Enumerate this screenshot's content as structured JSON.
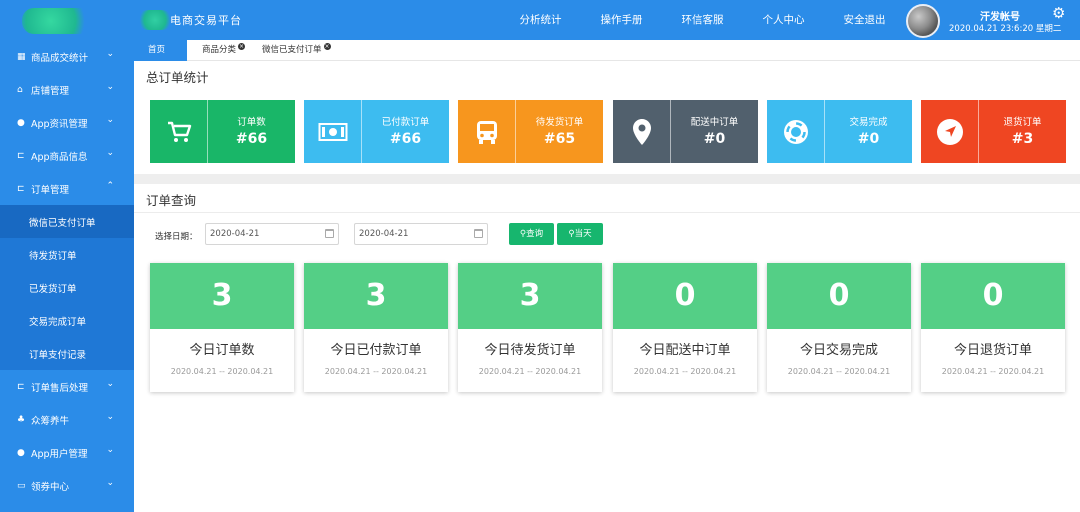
{
  "header": {
    "app_title": "电商交易平台",
    "nav": [
      "分析统计",
      "操作手册",
      "环信客服",
      "个人中心",
      "安全退出"
    ],
    "user_name": "汗发帐号",
    "datetime": "2020.04.21 23:6:20 星期二"
  },
  "sidebar": {
    "items": [
      {
        "label": "商品成交统计",
        "icon": "chart-icon"
      },
      {
        "label": "店铺管理",
        "icon": "store-icon"
      },
      {
        "label": "App资讯管理",
        "icon": "leaf-icon"
      },
      {
        "label": "App商品信息",
        "icon": "cart-icon"
      },
      {
        "label": "订单管理",
        "icon": "cart-icon"
      }
    ],
    "sub_items": [
      "微信已支付订单",
      "待发货订单",
      "已发货订单",
      "交易完成订单",
      "订单支付记录"
    ],
    "bottom_items": [
      {
        "label": "订单售后处理",
        "icon": "cart-icon"
      },
      {
        "label": "众筹养牛",
        "icon": "tree-icon"
      },
      {
        "label": "App用户管理",
        "icon": "apple-icon"
      },
      {
        "label": "领券中心",
        "icon": "ticket-icon"
      }
    ]
  },
  "tabs": [
    "首页",
    "商品分类",
    "微信已支付订单"
  ],
  "summary": {
    "title": "总订单统计",
    "cards": [
      {
        "label": "订单数",
        "value": "#66",
        "color": "#19b668",
        "icon": "cart-icon"
      },
      {
        "label": "已付款订单",
        "value": "#66",
        "color": "#3dbcf0",
        "icon": "money-icon"
      },
      {
        "label": "待发货订单",
        "value": "#65",
        "color": "#f7961e",
        "icon": "bus-icon"
      },
      {
        "label": "配送中订单",
        "value": "#0",
        "color": "#51606d",
        "icon": "location-pin-icon"
      },
      {
        "label": "交易完成",
        "value": "#0",
        "color": "#3dbcf0",
        "icon": "lifebuoy-icon"
      },
      {
        "label": "退货订单",
        "value": "#3",
        "color": "#ef4622",
        "icon": "navigation-arrow-icon"
      }
    ]
  },
  "query": {
    "title": "订单查询",
    "date_label": "选择日期：",
    "start_date": "2020-04-21",
    "end_date": "2020-04-21",
    "search_btn": "查询",
    "today_btn": "当天"
  },
  "today": {
    "cards": [
      {
        "value": "3",
        "label": "今日订单数",
        "range": "2020.04.21 -- 2020.04.21"
      },
      {
        "value": "3",
        "label": "今日已付款订单",
        "range": "2020.04.21 -- 2020.04.21"
      },
      {
        "value": "3",
        "label": "今日待发货订单",
        "range": "2020.04.21 -- 2020.04.21"
      },
      {
        "value": "0",
        "label": "今日配送中订单",
        "range": "2020.04.21 -- 2020.04.21"
      },
      {
        "value": "0",
        "label": "今日交易完成",
        "range": "2020.04.21 -- 2020.04.21"
      },
      {
        "value": "0",
        "label": "今日退货订单",
        "range": "2020.04.21 -- 2020.04.21"
      }
    ]
  }
}
